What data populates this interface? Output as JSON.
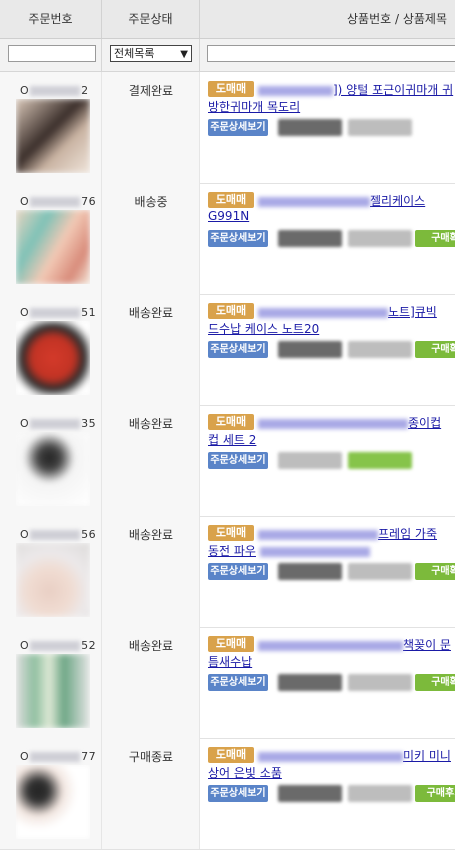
{
  "header": {
    "col_order_no": "주문번호",
    "col_status": "주문상태",
    "col_product": "상품번호 / 상품제목"
  },
  "filter": {
    "status_select": "전체목록"
  },
  "labels": {
    "tag": "도매매",
    "detail_button": "주문상세보기"
  },
  "orders": [
    {
      "prefix": "O",
      "suffix": "2",
      "status": "결제완료",
      "title1_tail": "]) 양털 포근이귀마개 귀",
      "title2": "방한귀마개 목도리",
      "green": ""
    },
    {
      "prefix": "O",
      "suffix": "76",
      "status": "배송중",
      "title1_tail": "젤리케이스",
      "title2": "G991N",
      "green": "구매확"
    },
    {
      "prefix": "O",
      "suffix": "51",
      "status": "배송완료",
      "title1_tail": "노트]큐빅",
      "title2": "드수납 케이스 노트20",
      "green": "구매확"
    },
    {
      "prefix": "O",
      "suffix": "35",
      "status": "배송완료",
      "title1_tail": "종이컵",
      "title2": "컵 세트 2",
      "green": ""
    },
    {
      "prefix": "O",
      "suffix": "56",
      "status": "배송완료",
      "title1_tail": "프레임 가죽",
      "title2": "동전 파우",
      "green": "구매확"
    },
    {
      "prefix": "O",
      "suffix": "52",
      "status": "배송완료",
      "title1_tail": "책꽂이 문",
      "title2": "틈새수납",
      "green": "구매확"
    },
    {
      "prefix": "O",
      "suffix": "77",
      "status": "구매종료",
      "title1_tail": "미키 미니",
      "title2": "상어 은빛 소품",
      "green": "구매후기"
    }
  ]
}
